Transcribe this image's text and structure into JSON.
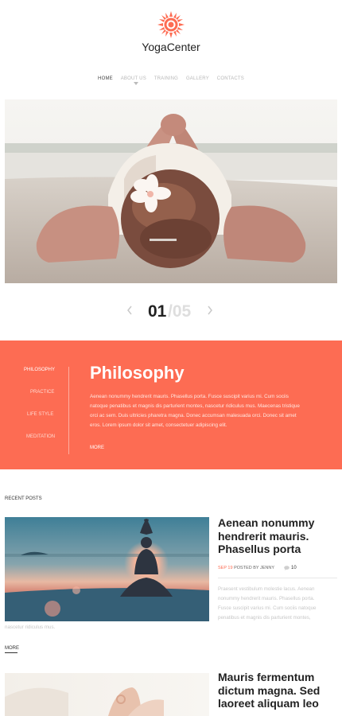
{
  "brand": {
    "name": "YogaCenter",
    "accent": "#fd6c53"
  },
  "nav": {
    "items": [
      "HOME",
      "ABOUT US",
      "TRAINING",
      "GALLERY",
      "CONTACTS"
    ],
    "active": "HOME"
  },
  "slider": {
    "current": "01",
    "total": "/05"
  },
  "philosophy": {
    "menu": [
      "PHILOSOPHY",
      "PRACTICE",
      "LIFE STYLE",
      "MEDITATION"
    ],
    "active": "PHILOSOPHY",
    "title": "Philosophy",
    "lines": [
      "Aenean nonummy hendrerit mauris. Phasellus porta. Fusce suscipit varius mi. Cum sociis",
      "natoque penatibus et magnis dis parturient montes, nascetur ridiculus mus. Maecenas tristique",
      "orci ac sem. Duis ultricies pharetra magna. Donec accumsan malesuada orci. Donec sit amet",
      "eros. Lorem ipsum dolor sit amet, consectetuer adipiscing elit."
    ],
    "more": "MORE"
  },
  "recent_posts": {
    "heading": "RECENT POSTS",
    "post1": {
      "title_lines": [
        "Aenean nonummy",
        "hendrerit mauris.",
        "Phasellus porta"
      ],
      "date": "SEP 19",
      "posted_by": "POSTED BY JENNY",
      "comments": "10",
      "excerpt_lines": [
        "Praesent vestibulum molestie lacus. Aenean",
        "nonummy hendrerit mauris. Phasellus porta.",
        "Fusce suscipit varius mi. Cum sociis natoque",
        "penatibus et magnis dis parturient montes,"
      ],
      "excerpt_tail": "nascetur ridiculus mus.",
      "more": "MORE"
    },
    "post2": {
      "title_lines": [
        "Mauris fermentum",
        "dictum magna. Sed",
        "laoreet aliquam leo"
      ]
    }
  }
}
